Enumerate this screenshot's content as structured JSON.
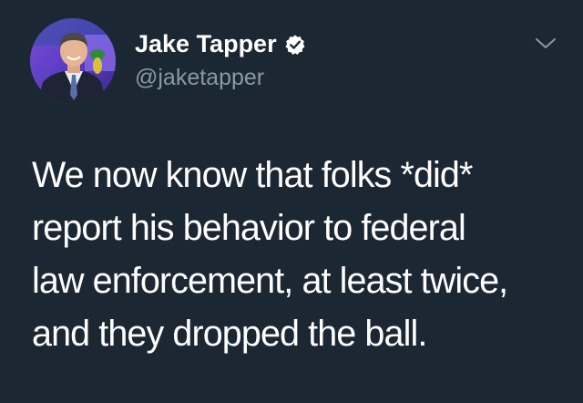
{
  "tweet": {
    "author": {
      "display_name": "Jake Tapper",
      "handle": "@jaketapper",
      "verified": true
    },
    "text_lines": [
      "We now know that folks *did*",
      "report his behavior to federal",
      "law enforcement, at least twice,",
      "and they dropped the ball."
    ],
    "menu_icon": "chevron-down-icon",
    "verified_icon": "verified-badge-icon",
    "colors": {
      "background": "#1c2734",
      "text": "#ffffff",
      "handle": "#8899a6",
      "chevron": "#8899a6"
    }
  }
}
